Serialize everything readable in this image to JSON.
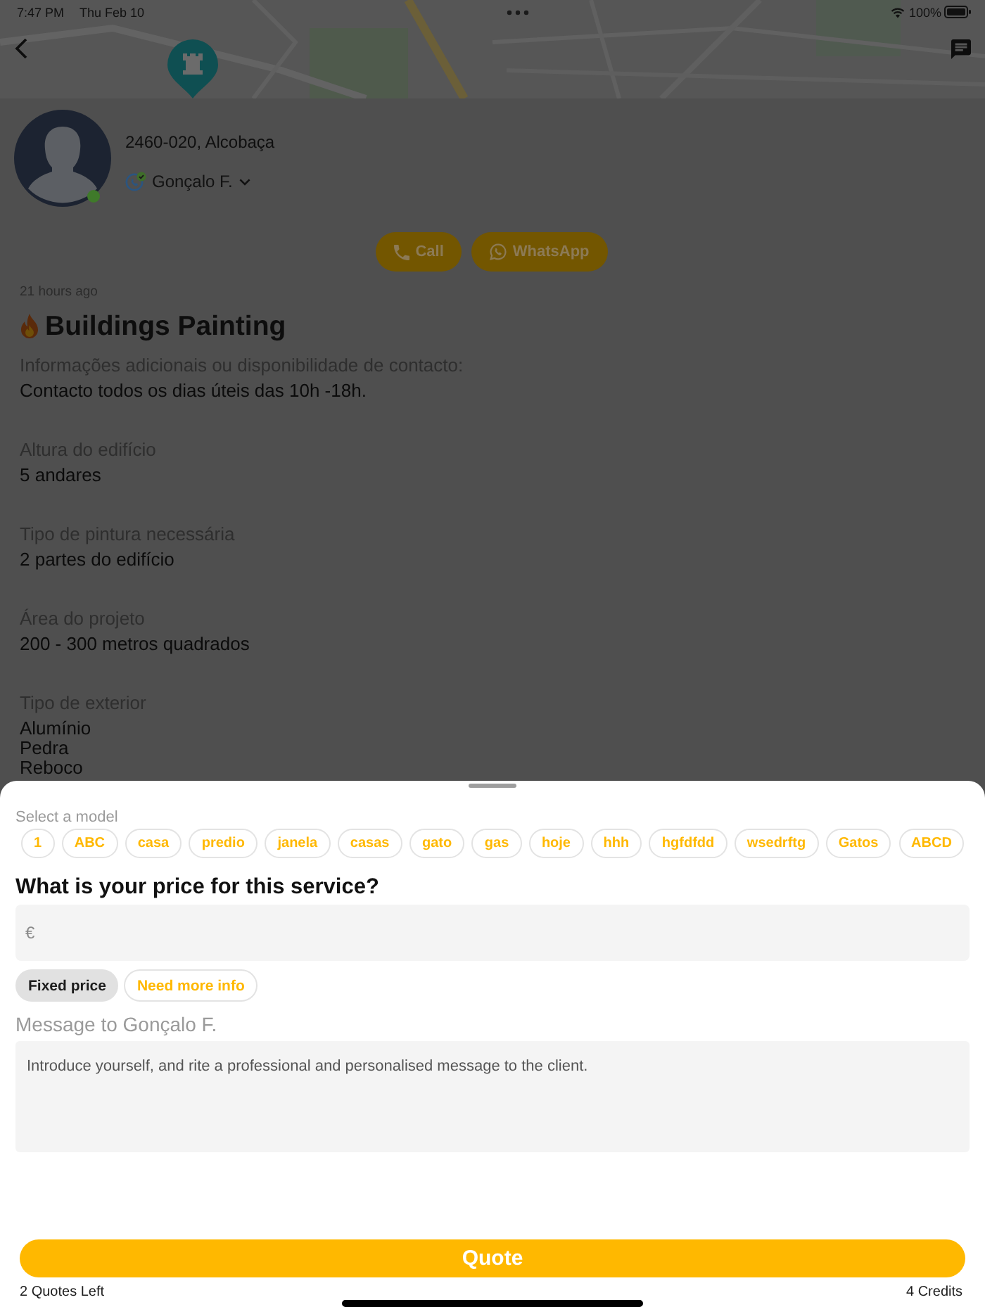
{
  "status_bar": {
    "time": "7:47 PM",
    "date": "Thu Feb 10",
    "battery": "100%"
  },
  "client": {
    "location": "2460-020, Alcobaça",
    "name": "Gonçalo F.",
    "online": true,
    "phone_verified": true
  },
  "contact_buttons": [
    {
      "kind": "call",
      "label": "Call"
    },
    {
      "kind": "whatsapp",
      "label": "WhatsApp"
    }
  ],
  "request": {
    "posted": "21 hours ago",
    "hot": true,
    "title": "Buildings Painting",
    "details": [
      {
        "label": "Informações adicionais ou disponibilidade de contacto:",
        "values": [
          "Contacto todos os dias úteis das 10h -18h."
        ]
      },
      {
        "label": "Altura do edifício",
        "values": [
          "5 andares"
        ]
      },
      {
        "label": "Tipo de pintura necessária",
        "values": [
          "2 partes do edifício"
        ]
      },
      {
        "label": "Área do projeto",
        "values": [
          "200 - 300 metros quadrados"
        ]
      },
      {
        "label": "Tipo de exterior",
        "values": [
          "Alumínio",
          "Pedra",
          "Reboco"
        ]
      }
    ]
  },
  "quote_sheet": {
    "model_label": "Select a model",
    "models": [
      {
        "label": "1",
        "selected": false
      },
      {
        "label": "ABC",
        "selected": false
      },
      {
        "label": "casa",
        "selected": false
      },
      {
        "label": "predio",
        "selected": false
      },
      {
        "label": "janela",
        "selected": false
      },
      {
        "label": "casas",
        "selected": false
      },
      {
        "label": "gato",
        "selected": false
      },
      {
        "label": "gas",
        "selected": false
      },
      {
        "label": "hoje",
        "selected": false
      },
      {
        "label": "hhh",
        "selected": false
      },
      {
        "label": "hgfdfdd",
        "selected": false
      },
      {
        "label": "wsedrftg",
        "selected": false
      },
      {
        "label": "Gatos",
        "selected": false
      },
      {
        "label": "ABCD",
        "selected": false
      }
    ],
    "price_question": "What is your price for this service?",
    "price_field": {
      "placeholder": "€"
    },
    "price_types": [
      {
        "label": "Fixed price",
        "selected": true
      },
      {
        "label": "Need more info",
        "selected": false
      }
    ],
    "message_label": "Message to Gonçalo F.",
    "message_field": {
      "placeholder": "Introduce yourself, and rite a professional and personalised message to the client."
    },
    "submit": "Quote",
    "quotes_left": "2 Quotes Left",
    "credits": "4 Credits"
  }
}
